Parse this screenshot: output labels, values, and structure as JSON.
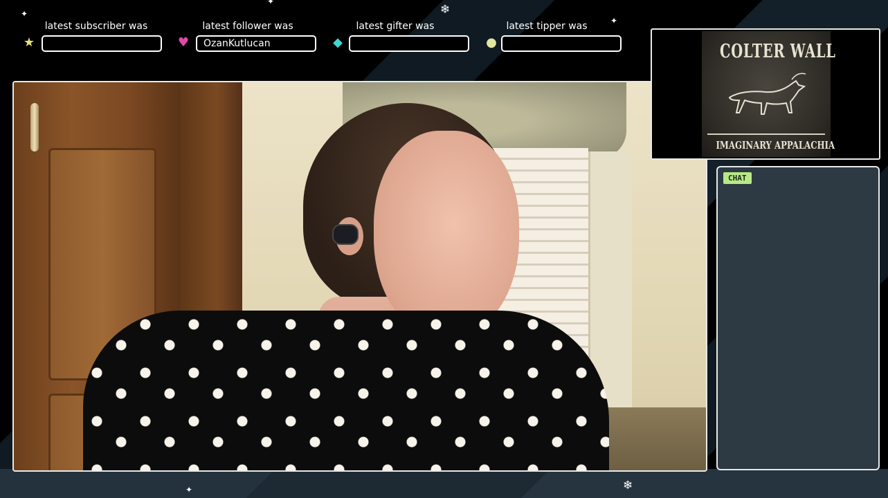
{
  "alerts": [
    {
      "label": "latest subscriber was",
      "value": "",
      "icon": "star-icon",
      "color": "#e8e17a"
    },
    {
      "label": "latest follower was",
      "value": "OzanKutlucan",
      "icon": "heart-icon",
      "color": "#e04aa6"
    },
    {
      "label": "latest gifter was",
      "value": "",
      "icon": "diamond-icon",
      "color": "#3fd6cf"
    },
    {
      "label": "latest tipper was",
      "value": "",
      "icon": "coin-icon",
      "color": "#e2e6a0"
    }
  ],
  "album": {
    "artist": "COLTER WALL",
    "title": "IMAGINARY APPALACHIA"
  },
  "chat": {
    "label": "CHAT"
  },
  "colors": {
    "background": "#000000",
    "frame": "#e9e9e9",
    "chat_bg": "#2d3a44",
    "chat_tag": "#b8e986"
  }
}
